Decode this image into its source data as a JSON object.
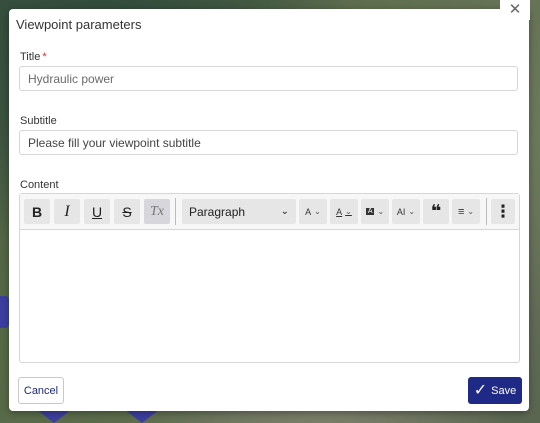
{
  "dialog": {
    "title": "Viewpoint parameters",
    "close_glyph": "✕"
  },
  "form": {
    "title_label": "Title",
    "required_mark": "*",
    "title_value": "Hydraulic power",
    "subtitle_label": "Subtitle",
    "subtitle_placeholder": "Please fill your viewpoint subtitle",
    "content_label": "Content"
  },
  "toolbar": {
    "bold": "B",
    "italic": "I",
    "underline": "U",
    "strike": "S",
    "clear_format": "Tx",
    "block_format": "Paragraph",
    "font_size": "A",
    "font_color": "A",
    "highlight": "A",
    "ai": "AI",
    "quote": "❝",
    "align": "≡",
    "more": "⋮"
  },
  "footer": {
    "cancel_label": "Cancel",
    "save_label": "Save"
  },
  "icons": {
    "close": "close-icon",
    "chevron": "chevron-down-icon",
    "save": "check-icon"
  }
}
